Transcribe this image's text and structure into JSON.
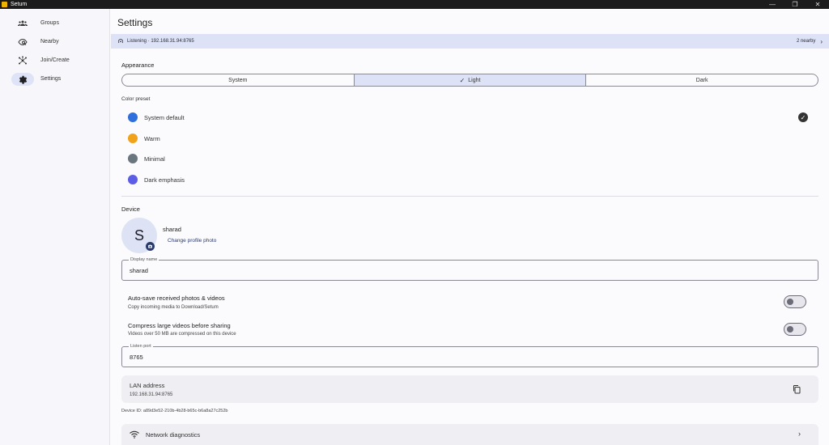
{
  "window": {
    "title": "Setum",
    "controls": [
      "—",
      "❐",
      "✕"
    ]
  },
  "sidebar": {
    "items": [
      {
        "label": "Groups",
        "icon": "groups-icon"
      },
      {
        "label": "Nearby",
        "icon": "radar-icon"
      },
      {
        "label": "Join/Create",
        "icon": "hub-icon"
      },
      {
        "label": "Settings",
        "icon": "gear-icon",
        "active": true
      }
    ]
  },
  "main": {
    "title": "Settings",
    "status": {
      "text": "Listening · 192.168.31.94:8765",
      "nearby": "2 nearby"
    },
    "appearance": {
      "label": "Appearance",
      "options": [
        "System",
        "Light",
        "Dark"
      ],
      "selected": "Light"
    },
    "color_preset": {
      "label": "Color preset",
      "items": [
        {
          "label": "System default",
          "color": "#2f6fdd",
          "selected": true
        },
        {
          "label": "Warm",
          "color": "#f0a21a"
        },
        {
          "label": "Minimal",
          "color": "#69757f"
        },
        {
          "label": "Dark emphasis",
          "color": "#5b5de6"
        }
      ]
    },
    "device": {
      "label": "Device",
      "avatar_initial": "S",
      "name": "sharad",
      "change_photo": "Change profile photo",
      "display_name_label": "Display name",
      "display_name_value": "sharad"
    },
    "toggles": [
      {
        "title": "Auto-save received photos & videos",
        "subtitle": "Copy incoming media to Download/Setum",
        "on": false
      },
      {
        "title": "Compress large videos before sharing",
        "subtitle": "Videos over 50 MB are compressed on this device",
        "on": false
      }
    ],
    "listen_port": {
      "label": "Listen port",
      "value": "8765"
    },
    "lan": {
      "title": "LAN address",
      "value": "192.168.31.94:8765"
    },
    "device_id": "Device ID: a89d3e52-210b-4b28-b65c-b6a8a27c252b",
    "diagnostics": {
      "label": "Network diagnostics"
    }
  }
}
